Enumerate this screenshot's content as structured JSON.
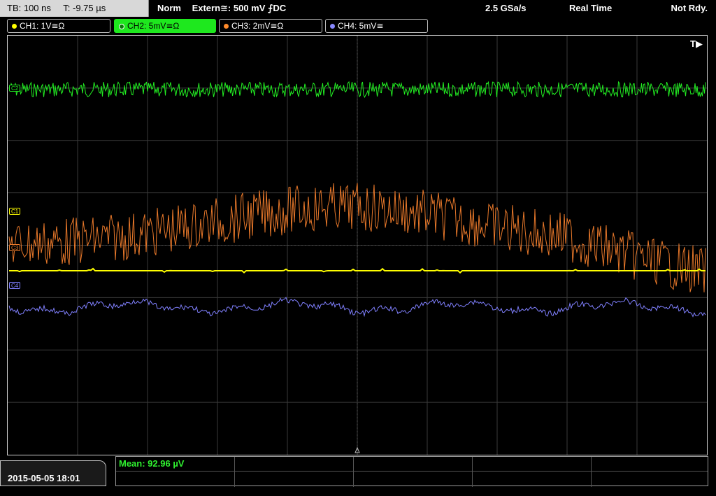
{
  "header": {
    "timebase": "TB: 100 ns",
    "trigger_time": "T: -9.75 µs",
    "trigger_mode": "Norm",
    "trigger_source": "Extern≅: 500 mV ⨍DC",
    "sample_rate": "2.5 GSa/s",
    "acq_mode": "Real Time",
    "status": "Not Rdy."
  },
  "channels": [
    {
      "label": "CH1: 1V≅Ω",
      "color": "#ffff00",
      "active": false
    },
    {
      "label": "CH2: 5mV≅Ω",
      "color": "#22ee22",
      "active": true
    },
    {
      "label": "CH3: 2mV≅Ω",
      "color": "#ff8a2a",
      "active": false
    },
    {
      "label": "CH4: 5mV≅",
      "color": "#8888ff",
      "active": false
    }
  ],
  "screen": {
    "trigger_marker": "T▶",
    "level_markers": {
      "c1": "C1",
      "c3": "C3",
      "c4": "C4",
      "c2": "C2"
    }
  },
  "footer": {
    "datetime": "2015-05-05 18:01",
    "measurement": "Mean: 92.96 µV"
  },
  "colors": {
    "ch1": "#ffff00",
    "ch2": "#22ee22",
    "ch3": "#e8782a",
    "ch4": "#8080ff",
    "grid": "#3a3a3a"
  }
}
